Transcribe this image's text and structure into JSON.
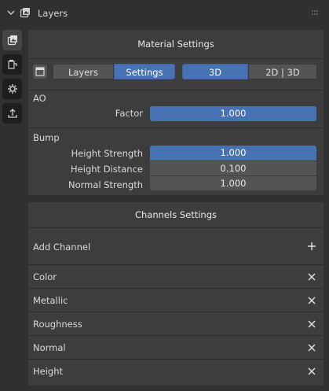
{
  "header": {
    "title": "Layers"
  },
  "material_panel": {
    "title": "Material Settings",
    "tabs": [
      "Layers",
      "Settings"
    ],
    "selected_tab": "Settings",
    "modes": [
      "3D",
      "2D | 3D"
    ],
    "selected_mode": "3D",
    "ao": {
      "label": "AO",
      "factor_label": "Factor",
      "factor_value": "1.000"
    },
    "bump": {
      "label": "Bump",
      "height_strength_label": "Height Strength",
      "height_strength_value": "1.000",
      "height_distance_label": "Height Distance",
      "height_distance_value": "0.100",
      "normal_strength_label": "Normal Strength",
      "normal_strength_value": "1.000"
    }
  },
  "channels_panel": {
    "title": "Channels Settings",
    "add_label": "Add Channel",
    "channels": [
      "Color",
      "Metallic",
      "Roughness",
      "Normal",
      "Height"
    ]
  },
  "icons": {
    "header": [
      "chevron-down-icon",
      "layers-icon",
      "drag-grip-icon"
    ],
    "sidebar": [
      "layers-icon",
      "paint-bucket-icon",
      "gear-icon",
      "export-icon"
    ],
    "row": [
      "window-icon",
      "plus-icon",
      "close-icon"
    ]
  },
  "colors": {
    "accent": "#4772b3",
    "panel": "#3d3d3d",
    "background": "#303030",
    "field": "#545454"
  }
}
